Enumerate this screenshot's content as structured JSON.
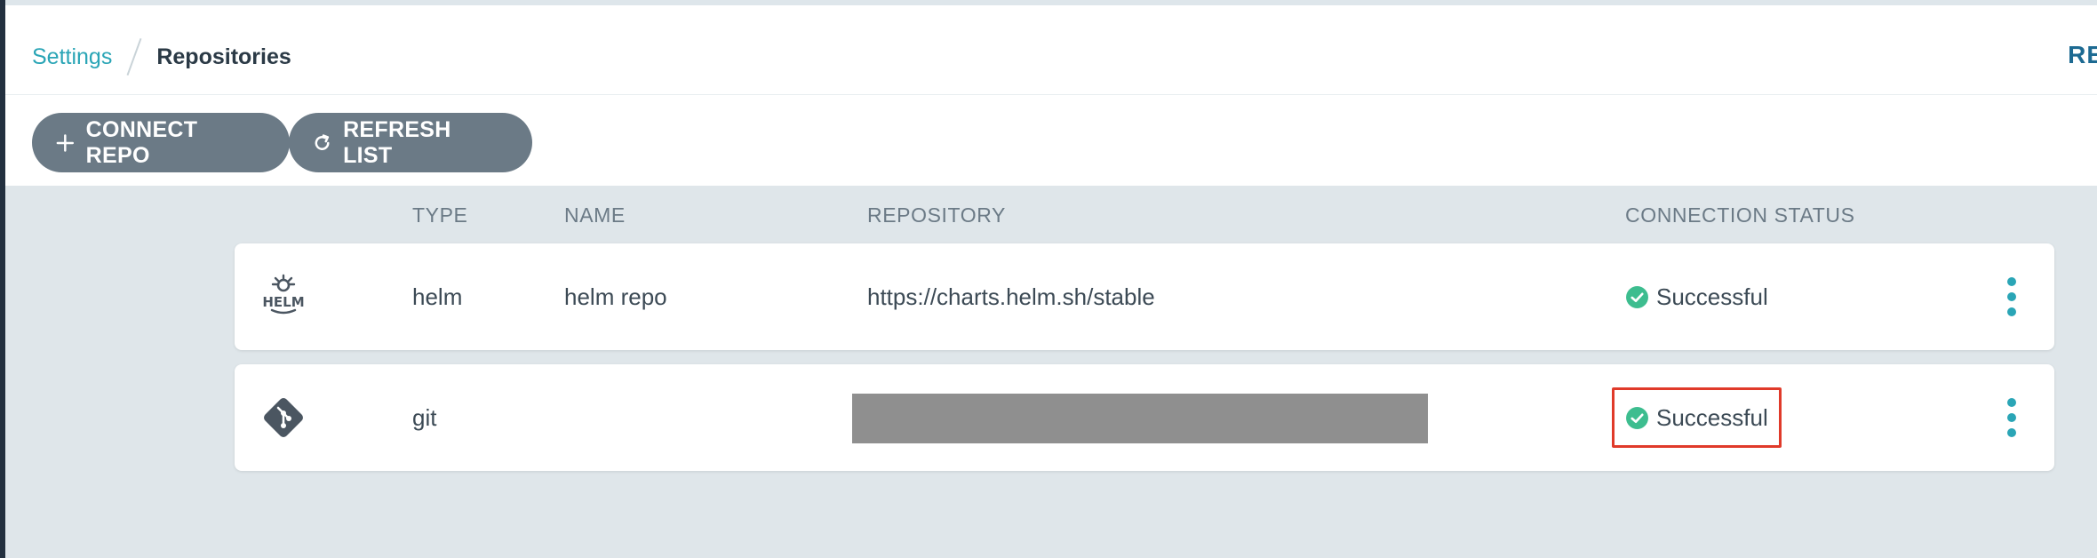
{
  "breadcrumb": {
    "parent": "Settings",
    "current": "Repositories"
  },
  "header": {
    "right_action": "RE"
  },
  "toolbar": {
    "connect_label": "CONNECT REPO",
    "refresh_label": "REFRESH LIST"
  },
  "table": {
    "columns": [
      "TYPE",
      "NAME",
      "REPOSITORY",
      "CONNECTION STATUS"
    ],
    "rows": [
      {
        "icon": "helm-icon",
        "type": "helm",
        "name": "helm repo",
        "repository": "https://charts.helm.sh/stable",
        "status": "Successful"
      },
      {
        "icon": "git-icon",
        "type": "git",
        "name": "",
        "repository": "[redacted]",
        "status": "Successful"
      }
    ]
  },
  "colors": {
    "accent": "#2aa5b6",
    "button_bg": "#6b7a86",
    "success": "#3dbd8f",
    "content_bg": "#dfe6ea",
    "highlight": "#e03a2a",
    "left_rail": "#23303f"
  }
}
